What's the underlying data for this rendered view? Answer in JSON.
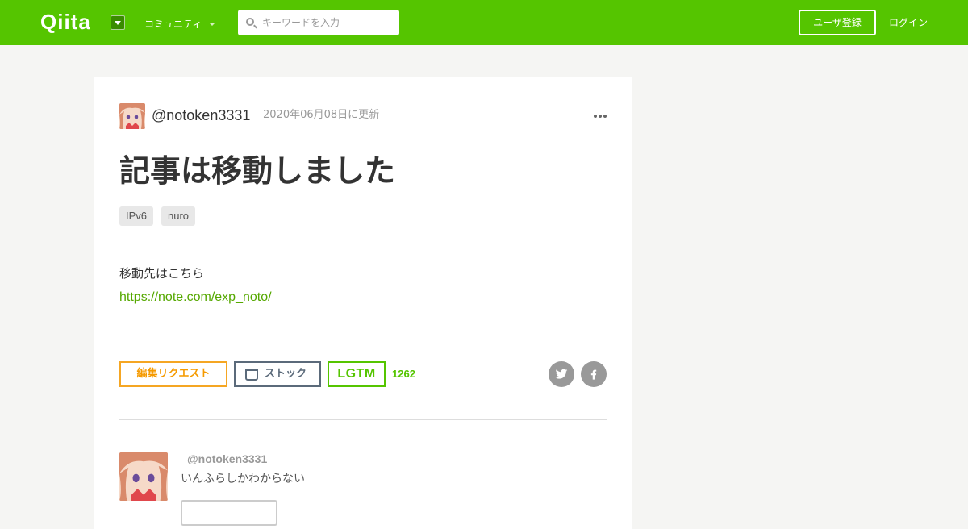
{
  "header": {
    "logo": "Qiita",
    "community_label": "コミュニティ",
    "search_placeholder": "キーワードを入力",
    "search_value": "",
    "signup_label": "ユーザ登録",
    "login_label": "ログイン",
    "brand_color": "#55c500"
  },
  "article": {
    "author": "@notoken3331",
    "updated": "2020年06月08日に更新",
    "title": "記事は移動しました",
    "tags": [
      "IPv6",
      "nuro"
    ],
    "body_text": "移動先はこちら",
    "link_text": "https://note.com/exp_noto/"
  },
  "actions": {
    "edit_request_label": "編集リクエスト",
    "stock_label": "ストック",
    "lgtm_label": "LGTM",
    "lgtm_count": "1262"
  },
  "profile": {
    "author": "@notoken3331",
    "bio": "いんふらしかわからない"
  }
}
